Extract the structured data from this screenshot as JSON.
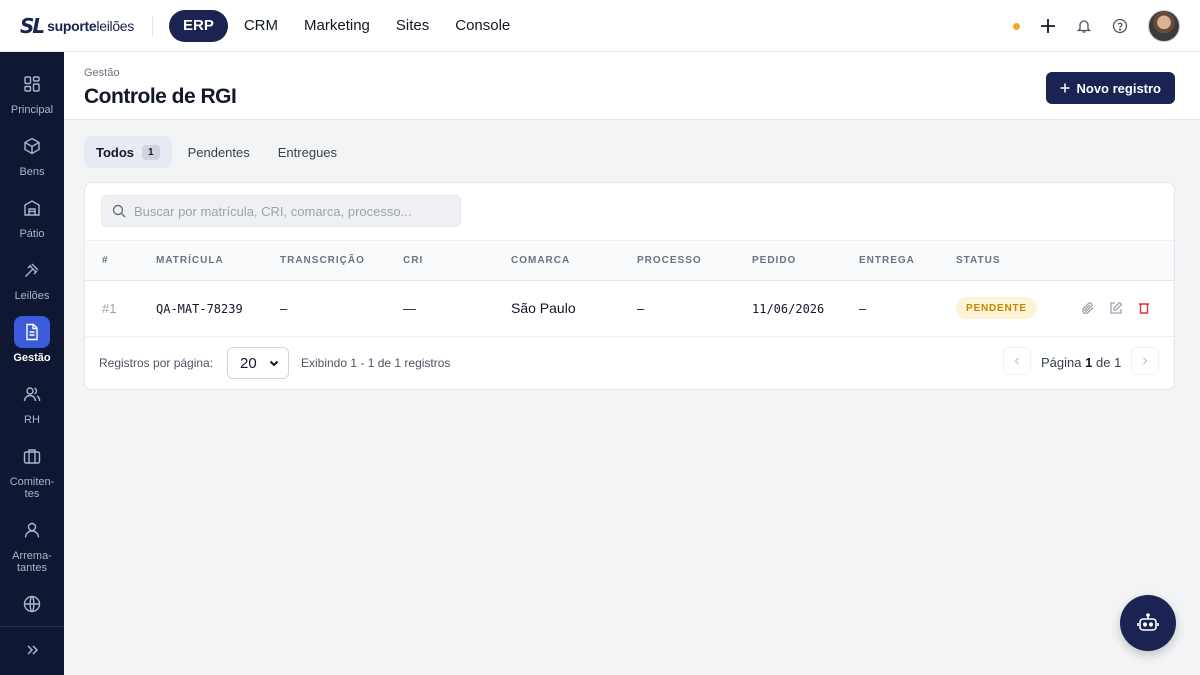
{
  "brand": {
    "mark": "SL",
    "name_bold": "suporte",
    "name_light": "leilões"
  },
  "nav": [
    {
      "label": "ERP",
      "active": true
    },
    {
      "label": "CRM"
    },
    {
      "label": "Marketing"
    },
    {
      "label": "Sites"
    },
    {
      "label": "Console"
    }
  ],
  "topbar": {
    "status_dot_color": "#f5a623",
    "icons": [
      "plus-icon",
      "bell-icon",
      "help-icon"
    ]
  },
  "sidebar": {
    "items": [
      {
        "label": "Principal",
        "icon": "grid-icon"
      },
      {
        "label": "Bens",
        "icon": "box-icon"
      },
      {
        "label": "Pátio",
        "icon": "warehouse-icon"
      },
      {
        "label": "Leilões",
        "icon": "gavel-icon"
      },
      {
        "label": "Gestão",
        "icon": "document-icon",
        "active": true
      },
      {
        "label": "RH",
        "icon": "users-icon"
      },
      {
        "label": "Comiten-tes",
        "line1": "Comiten-",
        "line2": "tes",
        "icon": "briefcase-icon"
      },
      {
        "label": "Arrema-tantes",
        "line1": "Arrema-",
        "line2": "tantes",
        "icon": "user-icon"
      },
      {
        "label": "",
        "icon": "globe-icon"
      }
    ],
    "collapse_icon": "chevrons-right-icon"
  },
  "header": {
    "breadcrumb": "Gestão",
    "title": "Controle de RGI",
    "new_button": "Novo registro"
  },
  "tabs": [
    {
      "label": "Todos",
      "count": "1",
      "active": true
    },
    {
      "label": "Pendentes"
    },
    {
      "label": "Entregues"
    }
  ],
  "search": {
    "placeholder": "Buscar por matrícula, CRI, comarca, processo..."
  },
  "table": {
    "columns": [
      "#",
      "MATRÍCULA",
      "TRANSCRIÇÃO",
      "CRI",
      "COMARCA",
      "PROCESSO",
      "PEDIDO",
      "ENTREGA",
      "STATUS"
    ],
    "rows": [
      {
        "num": "#1",
        "matricula": "QA-MAT-78239",
        "transcricao": "–",
        "cri": "—",
        "comarca": "São Paulo",
        "processo": "–",
        "pedido": "11/06/2026",
        "entrega": "–",
        "status": "PENDENTE"
      }
    ]
  },
  "pagination": {
    "per_page_label": "Registros por página:",
    "per_page_value": "20",
    "showing": "Exibindo 1 - 1 de 1 registros",
    "page_prefix": "Página",
    "page_current": "1",
    "page_of": "de",
    "page_total": "1"
  },
  "colors": {
    "navy": "#1a2352",
    "sidebar_bg": "#0f1733",
    "active_blue": "#3b5bdb",
    "pending_bg": "#fdf3d6",
    "pending_text": "#c48600",
    "danger": "#e03131"
  }
}
